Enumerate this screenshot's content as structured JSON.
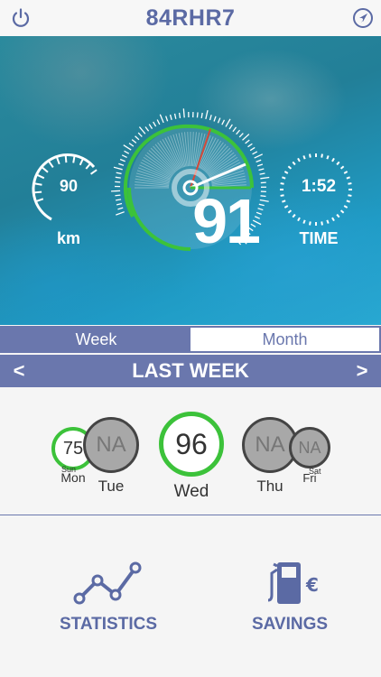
{
  "header": {
    "title": "84RHR7"
  },
  "gauges": {
    "distance": {
      "value": "90",
      "unit": "km"
    },
    "score": {
      "value": "91"
    },
    "time": {
      "value": "1:52",
      "unit": "TIME"
    }
  },
  "tabs": [
    {
      "label": "Week",
      "selected": true
    },
    {
      "label": "Month",
      "selected": false
    }
  ],
  "period": {
    "title": "LAST WEEK",
    "prev": "<",
    "next": ">"
  },
  "days": [
    {
      "day": "Sun",
      "score": "75"
    },
    {
      "day": "Mon",
      "score": ""
    },
    {
      "day": "Tue",
      "score": "NA"
    },
    {
      "day": "Wed",
      "score": "96"
    },
    {
      "day": "Thu",
      "score": "NA"
    },
    {
      "day": "Fri",
      "score": ""
    },
    {
      "day": "Sat",
      "score": "NA"
    }
  ],
  "actions": {
    "statistics": "STATISTICS",
    "savings": "SAVINGS",
    "currency_symbol": "€"
  },
  "colors": {
    "accent": "#5b6aa4",
    "tab_bar": "#6a77ad",
    "score_green": "#3cc23a",
    "needle_red": "#d24a3a"
  }
}
